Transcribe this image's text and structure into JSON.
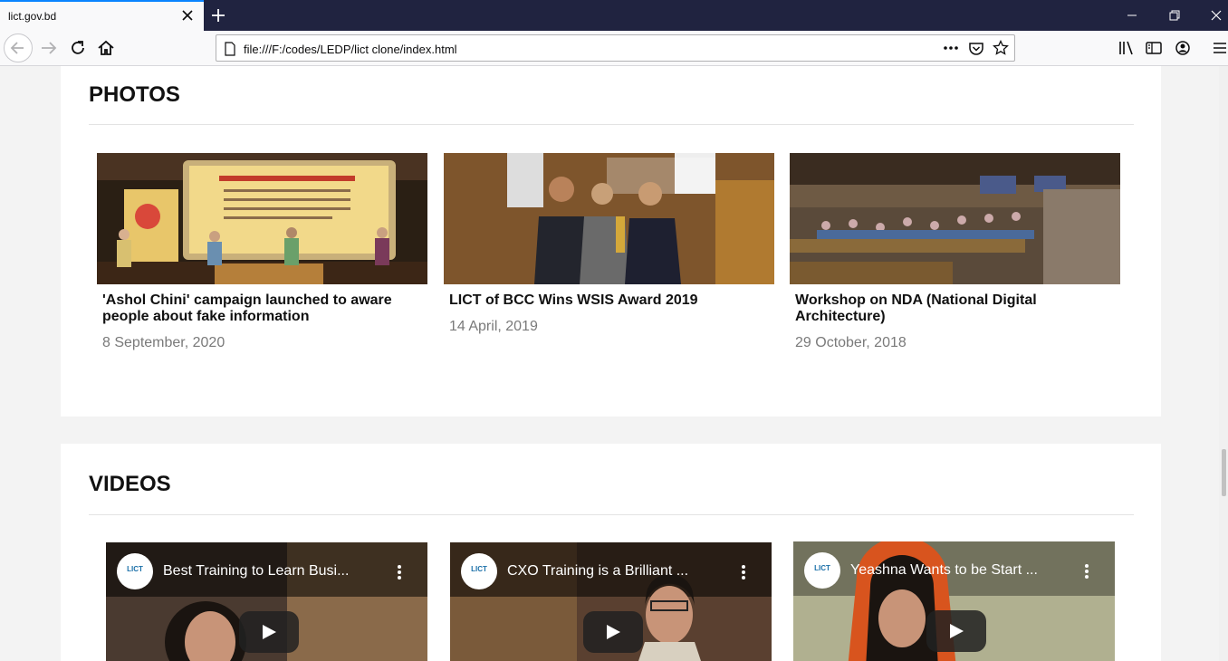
{
  "browser": {
    "tab_title": "lict.gov.bd",
    "url": "file:///F:/codes/LEDP/lict clone/index.html"
  },
  "photos": {
    "heading": "PHOTOS",
    "items": [
      {
        "title": "'Ashol Chini' campaign launched to aware people about fake information",
        "date": "8 September, 2020"
      },
      {
        "title": "LICT of BCC Wins WSIS Award 2019",
        "date": "14 April, 2019"
      },
      {
        "title": "Workshop on NDA (National Digital Architecture)",
        "date": "29 October, 2018"
      }
    ]
  },
  "videos": {
    "heading": "VIDEOS",
    "channel_logo": "LICT",
    "items": [
      {
        "title": "Best Training to Learn Busi..."
      },
      {
        "title": "CXO Training is a Brilliant ..."
      },
      {
        "title": "Yeashna Wants to be Start ..."
      }
    ]
  },
  "icons": {
    "tab_close": "close-icon",
    "new_tab": "plus-icon",
    "back": "arrow-left-icon",
    "forward": "arrow-right-icon",
    "reload": "reload-icon",
    "home": "home-icon",
    "page": "page-icon",
    "more": "ellipsis-icon",
    "pocket": "pocket-icon",
    "bookmark": "star-icon",
    "library": "library-icon",
    "sidebar": "sidebar-icon",
    "account": "account-icon",
    "menu": "hamburger-icon",
    "play": "play-icon"
  }
}
